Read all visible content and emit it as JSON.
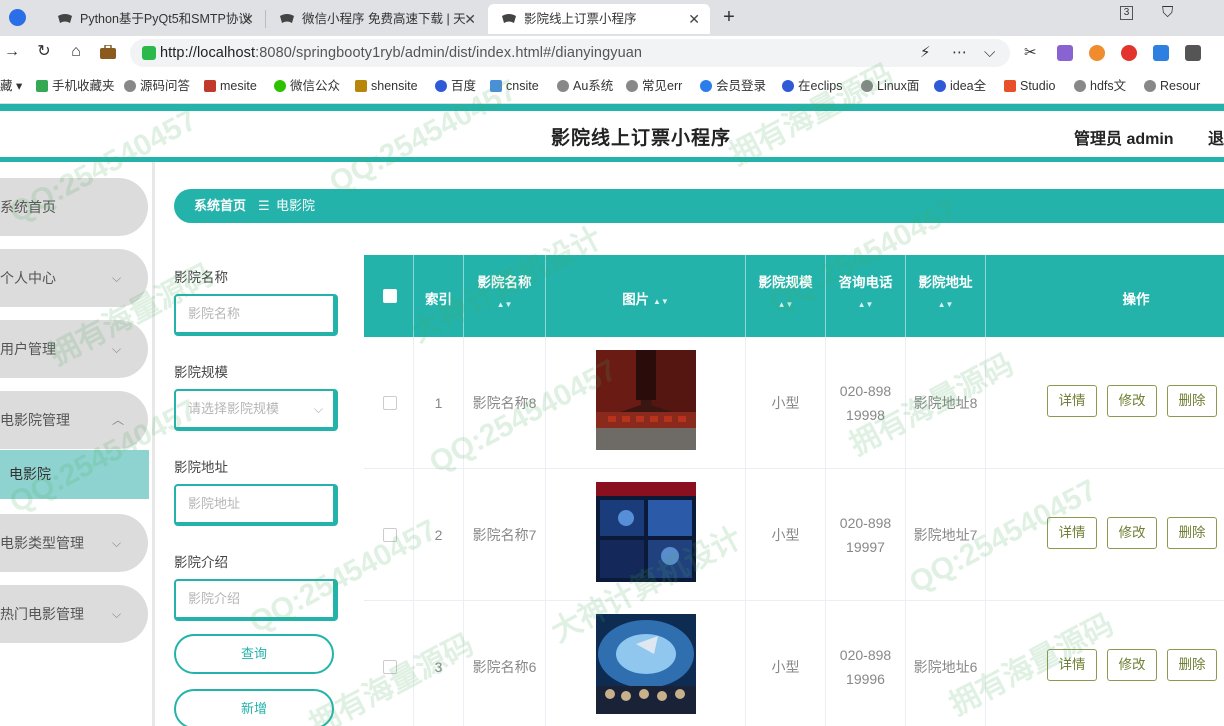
{
  "browser": {
    "tabs": [
      {
        "title": "Python基于PyQt5和SMTP协议"
      },
      {
        "title": "微信小程序 免费高速下载 | 天"
      },
      {
        "title": "影院线上订票小程序"
      }
    ],
    "tab_count_badge": "3",
    "url_host": "http://localhost",
    "url_rest": ":8080/springbooty1ryb/admin/dist/index.html#/dianyingyuan",
    "bookmarks": [
      "藏",
      "手机收藏夹",
      "源码问答",
      "mesite",
      "微信公众",
      "shensite",
      "百度",
      "cnsite",
      "Au系统",
      "常见err",
      "会员登录",
      "在eclips",
      "Linux面",
      "idea全",
      "Studio",
      "hdfs文",
      "Resour"
    ],
    "colors": {
      "accent": "#24b3ab",
      "tab_active": "#ffffff",
      "tabbar": "#dfe1e5"
    }
  },
  "app": {
    "title": "影院线上订票小程序",
    "admin": "管理员 admin",
    "logout": "退"
  },
  "sidebar": {
    "items": [
      {
        "label": "系统首页",
        "caret": ""
      },
      {
        "label": "个人中心",
        "caret": "⌵"
      },
      {
        "label": "用户管理",
        "caret": "⌵"
      },
      {
        "label": "电影院管理",
        "caret": "︿"
      },
      {
        "label": "电影类型管理",
        "caret": "⌵"
      },
      {
        "label": "热门电影管理",
        "caret": "⌵"
      }
    ],
    "active_sub": "电影院"
  },
  "breadcrumb": {
    "home": "系统首页",
    "sep": "☰",
    "current": "电影院"
  },
  "search": {
    "name_label": "影院名称",
    "name_placeholder": "影院名称",
    "scale_label": "影院规模",
    "scale_placeholder": "请选择影院规模",
    "address_label": "影院地址",
    "address_placeholder": "影院地址",
    "intro_label": "影院介绍",
    "intro_placeholder": "影院介绍",
    "query_btn": "查询",
    "add_btn": "新增"
  },
  "table": {
    "headers": {
      "index": "索引",
      "name": "影院名称",
      "image": "图片",
      "scale": "影院规模",
      "phone": "咨询电话",
      "address": "影院地址",
      "ops": "操作"
    },
    "sort_icon": "▲▼",
    "rows": [
      {
        "index": "1",
        "name": "影院名称8",
        "scale": "小型",
        "phone": "020-89819998",
        "address": "影院地址8"
      },
      {
        "index": "2",
        "name": "影院名称7",
        "scale": "小型",
        "phone": "020-89819997",
        "address": "影院地址7"
      },
      {
        "index": "3",
        "name": "影院名称6",
        "scale": "小型",
        "phone": "020-89819996",
        "address": "影院地址6"
      }
    ],
    "op_labels": {
      "detail": "详情",
      "edit": "修改",
      "delete": "删除"
    }
  },
  "watermark": [
    "QQ:254540457",
    "拥有海量源码",
    "大神计算机设计"
  ]
}
